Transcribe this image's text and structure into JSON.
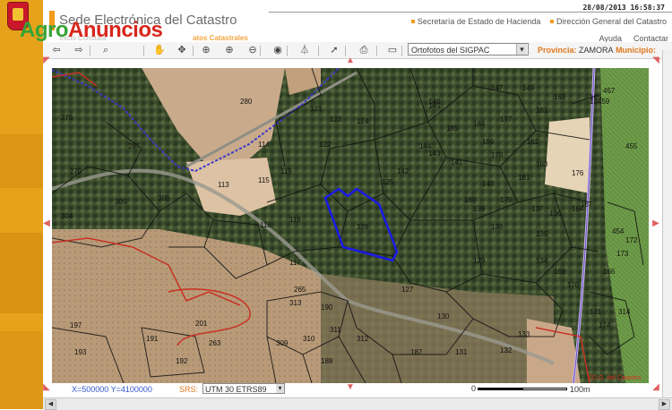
{
  "header": {
    "site_title": "Sede Electrónica del Catastro",
    "datetime": "28/08/2013 16:58:37",
    "link_secretaria": "Secretaría de Estado de Hacienda",
    "link_direccion": "Dirección General del Catastro",
    "ayuda": "Ayuda",
    "contactar": "Contactar",
    "subtab_left": "Inicio     Consulta",
    "subtab_right": "atos Catastrales",
    "watermark_agro": "Agro",
    "watermark_anuncios": "Anuncios"
  },
  "toolbar": {
    "tools": [
      {
        "icon": "arrow-left-icon",
        "glyph": "⇦"
      },
      {
        "icon": "arrow-right-icon",
        "glyph": "⇨"
      },
      {
        "icon": "binoculars-icon",
        "glyph": "⌕"
      },
      {
        "icon": "hand-pan-icon",
        "glyph": "✋"
      },
      {
        "icon": "move-icon",
        "glyph": "✥"
      },
      {
        "icon": "zoom-box-icon",
        "glyph": "⊕"
      },
      {
        "icon": "zoom-in-icon",
        "glyph": "⊕"
      },
      {
        "icon": "zoom-out-icon",
        "glyph": "⊖"
      },
      {
        "icon": "globe-icon",
        "glyph": "◉"
      },
      {
        "icon": "measure-icon",
        "glyph": "⏃"
      },
      {
        "icon": "info-cursor-icon",
        "glyph": "➚"
      },
      {
        "icon": "print-icon",
        "glyph": "⎙"
      },
      {
        "icon": "layers-icon",
        "glyph": "▭"
      }
    ],
    "layer_select": "Ortofotos del SIGPAC",
    "provincia_label": "Provincia:",
    "provincia_value": "ZAMORA",
    "municipio_label": "Municipio:"
  },
  "map": {
    "parcels": [
      "276",
      "267",
      "270",
      "280",
      "304",
      "305",
      "306",
      "113",
      "115",
      "116",
      "118",
      "117",
      "119",
      "114",
      "121",
      "122",
      "123",
      "124",
      "125",
      "126",
      "127",
      "129",
      "130",
      "131",
      "132",
      "133",
      "134",
      "135",
      "136",
      "137",
      "138",
      "139",
      "140",
      "141",
      "142",
      "143",
      "144",
      "145",
      "146",
      "147",
      "149",
      "161",
      "162",
      "163",
      "164",
      "165",
      "166",
      "167",
      "168",
      "170",
      "171",
      "172",
      "173",
      "174",
      "176",
      "177",
      "178",
      "179",
      "180",
      "181",
      "183",
      "184",
      "185",
      "186",
      "187",
      "188",
      "190",
      "191",
      "192",
      "193",
      "197",
      "201",
      "263",
      "265",
      "309",
      "310",
      "311",
      "312",
      "313",
      "314",
      "454",
      "455",
      "457",
      "10459"
    ],
    "copyright": "©D.G. del Catastro"
  },
  "status": {
    "coords": "X=500000 Y=4100000",
    "srs_label": "SRS:",
    "srs_value": "UTM 30 ETRS89",
    "scale_start": "0",
    "scale_end": "100m"
  },
  "colors": {
    "accent": "#f29a1c",
    "parcel_line": "#1a1a1a",
    "selection": "#1010e0",
    "boundary": "#3a38c8"
  }
}
